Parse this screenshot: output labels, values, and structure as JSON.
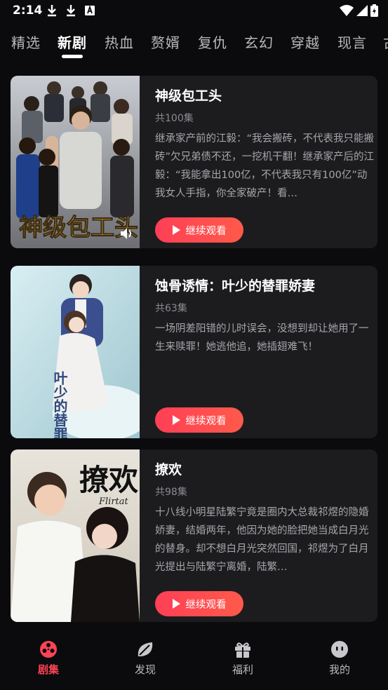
{
  "status": {
    "time": "2:14"
  },
  "tabs": [
    {
      "label": "精选"
    },
    {
      "label": "新剧"
    },
    {
      "label": "热血"
    },
    {
      "label": "赘婿"
    },
    {
      "label": "复仇"
    },
    {
      "label": "玄幻"
    },
    {
      "label": "穿越"
    },
    {
      "label": "现言"
    },
    {
      "label": "古"
    }
  ],
  "active_tab": "新剧",
  "dramas": [
    {
      "title": "神级包工头",
      "episodes": "共100集",
      "description": "继承家产前的江毅：“我会搬砖，不代表我只能搬砖”欠兄弟债不还，一挖机干翻！继承家产后的江毅：“我能拿出100亿，不代表我只有100亿”动我女人手指，你全家破产！看…",
      "button": "继续观看",
      "poster_text": "神级包工头"
    },
    {
      "title": "蚀骨诱情：叶少的替罪娇妻",
      "episodes": "共63集",
      "description": "一场阴差阳错的儿时误会，没想到却让她用了一生来赎罪！她逃他追，她插翅难飞！",
      "button": "继续观看",
      "poster_text": "叶少的替罪娇妻"
    },
    {
      "title": "撩欢",
      "episodes": "共98集",
      "description": "十八线小明星陆繁宁竟是圈内大总裁祁煜的隐婚娇妻，结婚两年，他因为她的脸把她当成白月光的替身。却不想白月光突然回国，祁煜为了白月光提出与陆繁宁离婚，陆繁…",
      "button": "继续观看",
      "poster_text": "撩欢",
      "poster_subtext": "Flirtat"
    }
  ],
  "bottom_nav": [
    {
      "label": "剧集",
      "icon": "film-reel-icon"
    },
    {
      "label": "发现",
      "icon": "leaf-icon"
    },
    {
      "label": "福利",
      "icon": "gift-icon"
    },
    {
      "label": "我的",
      "icon": "face-icon"
    }
  ],
  "colors": {
    "accent": "#ff4356",
    "background": "#0b0b0d",
    "card": "#1c1c1f"
  }
}
